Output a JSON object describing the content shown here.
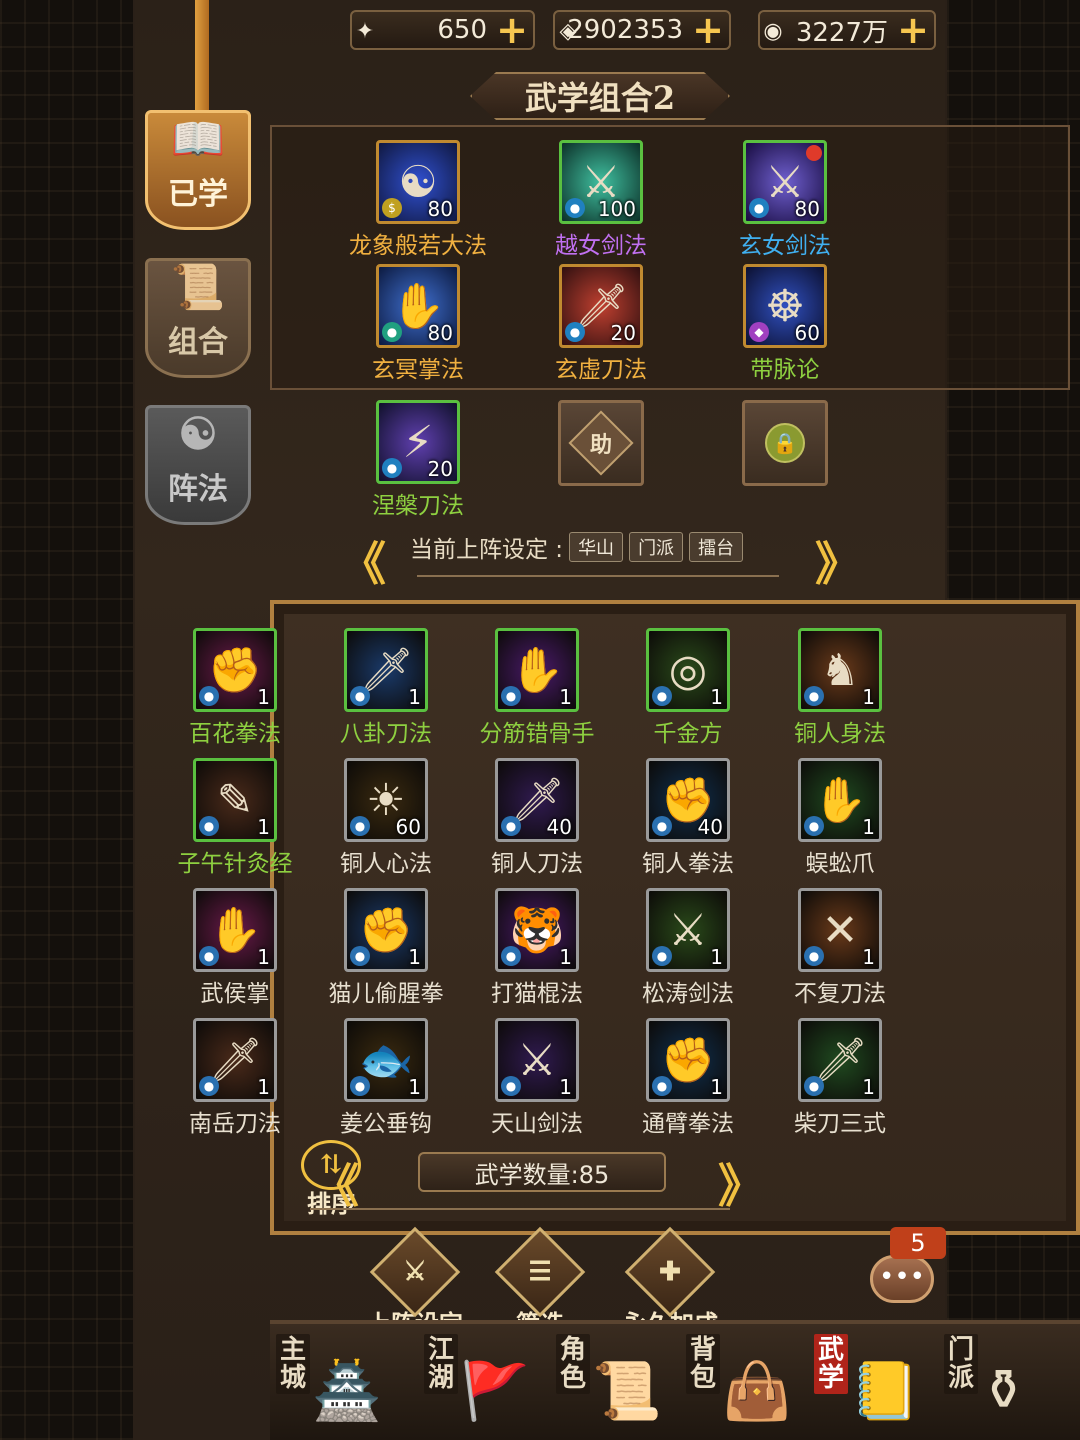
{
  "currency": [
    {
      "icon": "sword-scroll-icon",
      "value": "650"
    },
    {
      "icon": "gold-ingot-icon",
      "value": "2902353"
    },
    {
      "icon": "silver-coin-icon",
      "value": "3227万"
    }
  ],
  "side_tabs": [
    {
      "label": "已学",
      "active": true
    },
    {
      "label": "组合",
      "active": false
    },
    {
      "label": "阵法",
      "active": false
    }
  ],
  "combo": {
    "title": "武学组合2",
    "slots": [
      {
        "name": "龙象般若大法",
        "level": "80",
        "color": "gold",
        "glyph": "☯"
      },
      {
        "name": "越女剑法",
        "level": "100",
        "color": "purple",
        "glyph": "⚔"
      },
      {
        "name": "玄女剑法",
        "level": "80",
        "color": "blue",
        "glyph": "⚔"
      },
      {
        "name": "玄冥掌法",
        "level": "80",
        "color": "blue",
        "glyph": "✋"
      },
      {
        "name": "玄虚刀法",
        "level": "20",
        "color": "blue",
        "glyph": "🗡"
      },
      {
        "name": "带脉论",
        "level": "60",
        "color": "green",
        "glyph": "☸"
      },
      {
        "name": "涅槃刀法",
        "level": "20",
        "color": "green",
        "glyph": "⚡"
      }
    ],
    "assist_label": "助"
  },
  "deploy_setting": {
    "label": "当前上阵设定 :",
    "tags": [
      "华山",
      "门派",
      "擂台"
    ]
  },
  "skills": [
    {
      "name": "百花拳法",
      "level": "1",
      "color": "green",
      "glyph": "✊"
    },
    {
      "name": "八卦刀法",
      "level": "1",
      "color": "green",
      "glyph": "🗡"
    },
    {
      "name": "分筋错骨手",
      "level": "1",
      "color": "green",
      "glyph": "✋"
    },
    {
      "name": "千金方",
      "level": "1",
      "color": "green",
      "glyph": "◎"
    },
    {
      "name": "铜人身法",
      "level": "1",
      "color": "green",
      "glyph": "♞"
    },
    {
      "name": "子午针灸经",
      "level": "1",
      "color": "green",
      "glyph": "✎"
    },
    {
      "name": "铜人心法",
      "level": "60",
      "color": "white",
      "glyph": "☀"
    },
    {
      "name": "铜人刀法",
      "level": "40",
      "color": "white",
      "glyph": "🗡"
    },
    {
      "name": "铜人拳法",
      "level": "40",
      "color": "white",
      "glyph": "✊"
    },
    {
      "name": "蜈蚣爪",
      "level": "1",
      "color": "white",
      "glyph": "✋"
    },
    {
      "name": "武侯掌",
      "level": "1",
      "color": "white",
      "glyph": "✋"
    },
    {
      "name": "猫儿偷腥拳",
      "level": "1",
      "color": "white",
      "glyph": "✊"
    },
    {
      "name": "打猫棍法",
      "level": "1",
      "color": "white",
      "glyph": "🐯"
    },
    {
      "name": "松涛剑法",
      "level": "1",
      "color": "white",
      "glyph": "⚔"
    },
    {
      "name": "不复刀法",
      "level": "1",
      "color": "white",
      "glyph": "✕"
    },
    {
      "name": "南岳刀法",
      "level": "1",
      "color": "white",
      "glyph": "🗡"
    },
    {
      "name": "姜公垂钩",
      "level": "1",
      "color": "white",
      "glyph": "🐟"
    },
    {
      "name": "天山剑法",
      "level": "1",
      "color": "white",
      "glyph": "⚔"
    },
    {
      "name": "通臂拳法",
      "level": "1",
      "color": "white",
      "glyph": "✊"
    },
    {
      "name": "柴刀三式",
      "level": "1",
      "color": "white",
      "glyph": "🗡"
    }
  ],
  "skill_count": "武学数量:85",
  "sort_label": "排序",
  "actions": [
    {
      "label": "上阵设定",
      "icon": "formation-icon"
    },
    {
      "label": "筛选",
      "icon": "filter-icon"
    },
    {
      "label": "永久加成",
      "icon": "scroll-plus-icon"
    }
  ],
  "chat_count": "5",
  "bottom_nav": [
    {
      "label": "主城",
      "icon": "palace-icon",
      "active": false
    },
    {
      "label": "江湖",
      "icon": "flag-icon",
      "active": false
    },
    {
      "label": "角色",
      "icon": "scroll-icon",
      "active": false
    },
    {
      "label": "背包",
      "icon": "bag-icon",
      "active": false
    },
    {
      "label": "武学",
      "icon": "book-icon",
      "active": true
    },
    {
      "label": "门派",
      "icon": "cauldron-icon",
      "active": false
    }
  ],
  "colors": {
    "gold": "#f0b040",
    "purple": "#c070f0",
    "blue": "#40b0f0",
    "green": "#8ed040",
    "white": "#e8e0d0"
  }
}
